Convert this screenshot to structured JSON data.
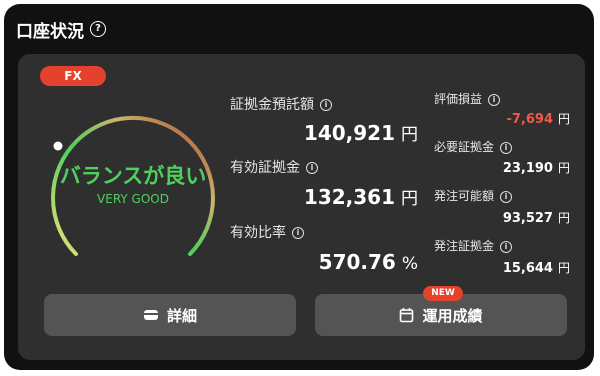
{
  "header": {
    "title": "口座状況",
    "help_icon": "question-circle-icon"
  },
  "badge": "FX",
  "gauge": {
    "status": "バランスが良い",
    "sub": "VERY GOOD",
    "level_fraction": 0.62
  },
  "left_metrics": {
    "deposit": {
      "label": "証拠金預託額",
      "value": "140,921",
      "unit": "円"
    },
    "effective": {
      "label": "有効証拠金",
      "value": "132,361",
      "unit": "円"
    },
    "ratio": {
      "label": "有効比率",
      "value": "570.76",
      "unit": "%"
    }
  },
  "right_metrics": {
    "pl": {
      "label": "評価損益",
      "value": "-7,694",
      "unit": "円"
    },
    "required": {
      "label": "必要証拠金",
      "value": "23,190",
      "unit": "円"
    },
    "orderable": {
      "label": "発注可能額",
      "value": "93,527",
      "unit": "円"
    },
    "order_margin": {
      "label": "発注証拠金",
      "value": "15,644",
      "unit": "円"
    }
  },
  "buttons": {
    "detail": {
      "label": "詳細",
      "icon": "wallet-icon"
    },
    "history": {
      "label": "運用成績",
      "icon": "calendar-icon",
      "badge": "NEW"
    }
  },
  "colors": {
    "accent": "#e5422d",
    "good": "#4fcf5c",
    "negative": "#ee5b47"
  }
}
